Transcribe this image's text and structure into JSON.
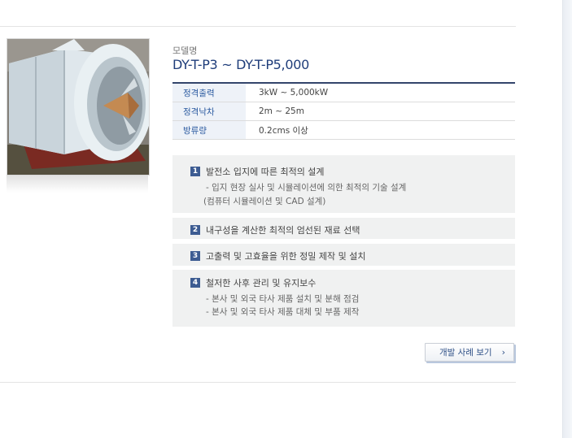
{
  "model": {
    "caption": "모델명",
    "name": "DY-T-P3 ~ DY-T-P5,000"
  },
  "specs": [
    {
      "label": "정격출력",
      "value": "3kW ~ 5,000kW"
    },
    {
      "label": "정격낙차",
      "value": "2m ~ 25m"
    },
    {
      "label": "방류량",
      "value": "0.2cms 이상"
    }
  ],
  "features": [
    {
      "num": "1",
      "title": "발전소 입지에 따른 최적의 설계",
      "details": [
        "- 입지 현장 실사 및 시뮬레이션에 의한 최적의 기술 설계",
        "(컴퓨터 시뮬레이션 및 CAD 설계)"
      ]
    },
    {
      "num": "2",
      "title": "내구성을 계산한 최적의 엄선된 재료 선택",
      "details": []
    },
    {
      "num": "3",
      "title": "고출력 및 고효율을 위한 정밀 제작 및 설치",
      "details": []
    },
    {
      "num": "4",
      "title": "철저한 사후 관리 및 유지보수",
      "details": [
        "- 본사 및 외국 타사 제품 설치 및 분해 점검",
        "- 본사 및 외국 타사 제품 대체 및 부품 제작"
      ]
    }
  ],
  "button": {
    "label": "개발 사례 보기",
    "icon": "chevron-right-icon"
  },
  "colors": {
    "accent": "#1f3d7a",
    "badge": "#3d5c92",
    "panel": "#f0f1f1"
  }
}
